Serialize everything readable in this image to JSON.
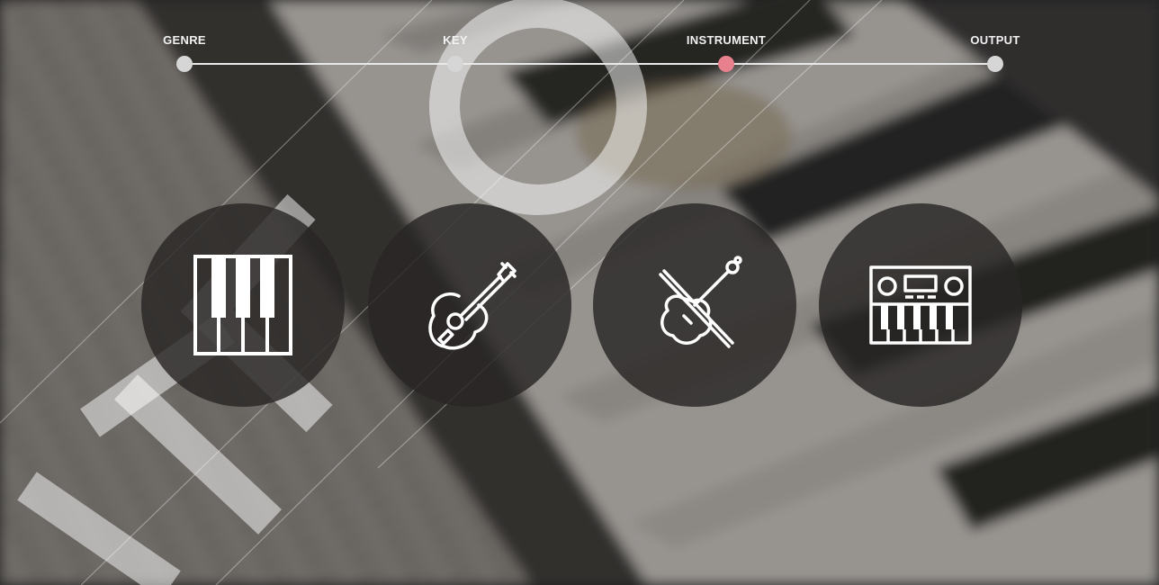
{
  "progress": {
    "steps": [
      {
        "label": "GENRE",
        "state": "done"
      },
      {
        "label": "KEY",
        "state": "done"
      },
      {
        "label": "INSTRUMENT",
        "state": "current"
      },
      {
        "label": "OUTPUT",
        "state": "pending"
      }
    ],
    "current_step": 3
  },
  "instruments": [
    {
      "name": "piano",
      "icon": "piano-keys-icon"
    },
    {
      "name": "guitar",
      "icon": "acoustic-guitar-icon"
    },
    {
      "name": "violin",
      "icon": "violin-icon"
    },
    {
      "name": "synth",
      "icon": "synthesizer-icon"
    }
  ],
  "colors": {
    "circle_bg": "rgba(40,38,36,0.82)",
    "step_dot": "#d6d6d6",
    "step_dot_active": "#e8808e",
    "line": "#e9e9e9",
    "icon": "#ffffff"
  }
}
